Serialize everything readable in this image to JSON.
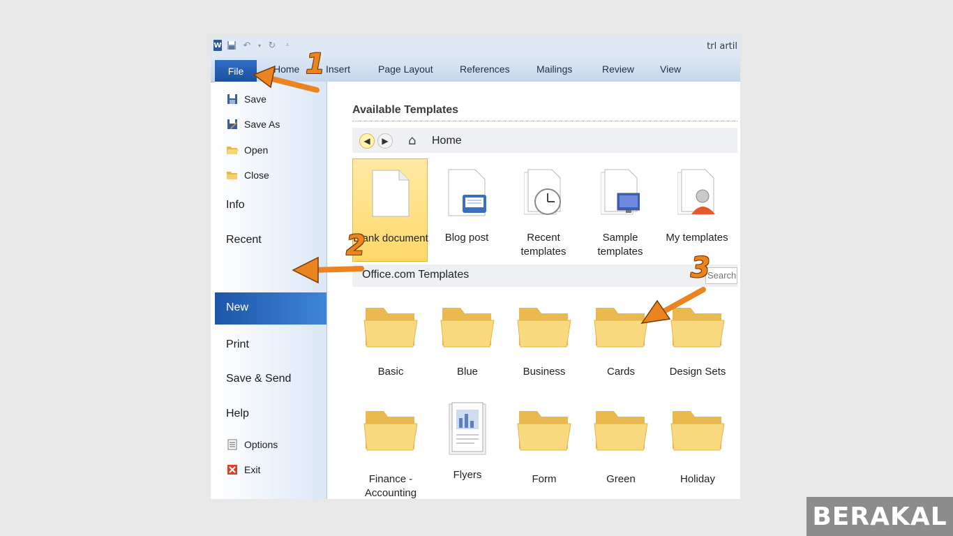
{
  "window": {
    "doc_title": "trl artil"
  },
  "ribbon": {
    "file_tab": "File",
    "tabs": [
      "Home",
      "Insert",
      "Page Layout",
      "References",
      "Mailings",
      "Review",
      "View"
    ]
  },
  "backstage": {
    "small_items": [
      "Save",
      "Save As",
      "Open",
      "Close"
    ],
    "big_items": [
      "Info",
      "Recent",
      "New",
      "Print",
      "Save & Send",
      "Help"
    ],
    "bottom_items": [
      "Options",
      "Exit"
    ]
  },
  "main": {
    "available_title": "Available Templates",
    "nav_home": "Home",
    "templates": [
      {
        "label": "Blank document",
        "selected": true
      },
      {
        "label": "Blog post"
      },
      {
        "label": "Recent templates"
      },
      {
        "label": "Sample templates"
      },
      {
        "label": "My templates"
      }
    ],
    "office_title": "Office.com Templates",
    "search_placeholder": "Search",
    "categories_row1": [
      "Basic",
      "Blue",
      "Business",
      "Cards",
      "Design Sets"
    ],
    "categories_row2": [
      "Finance - Accounting",
      "Flyers",
      "Form",
      "Green",
      "Holiday"
    ]
  },
  "annotations": {
    "step1": "1",
    "step2": "2",
    "step3": "3",
    "color": "#e98421"
  },
  "watermark": "BERAKAL"
}
